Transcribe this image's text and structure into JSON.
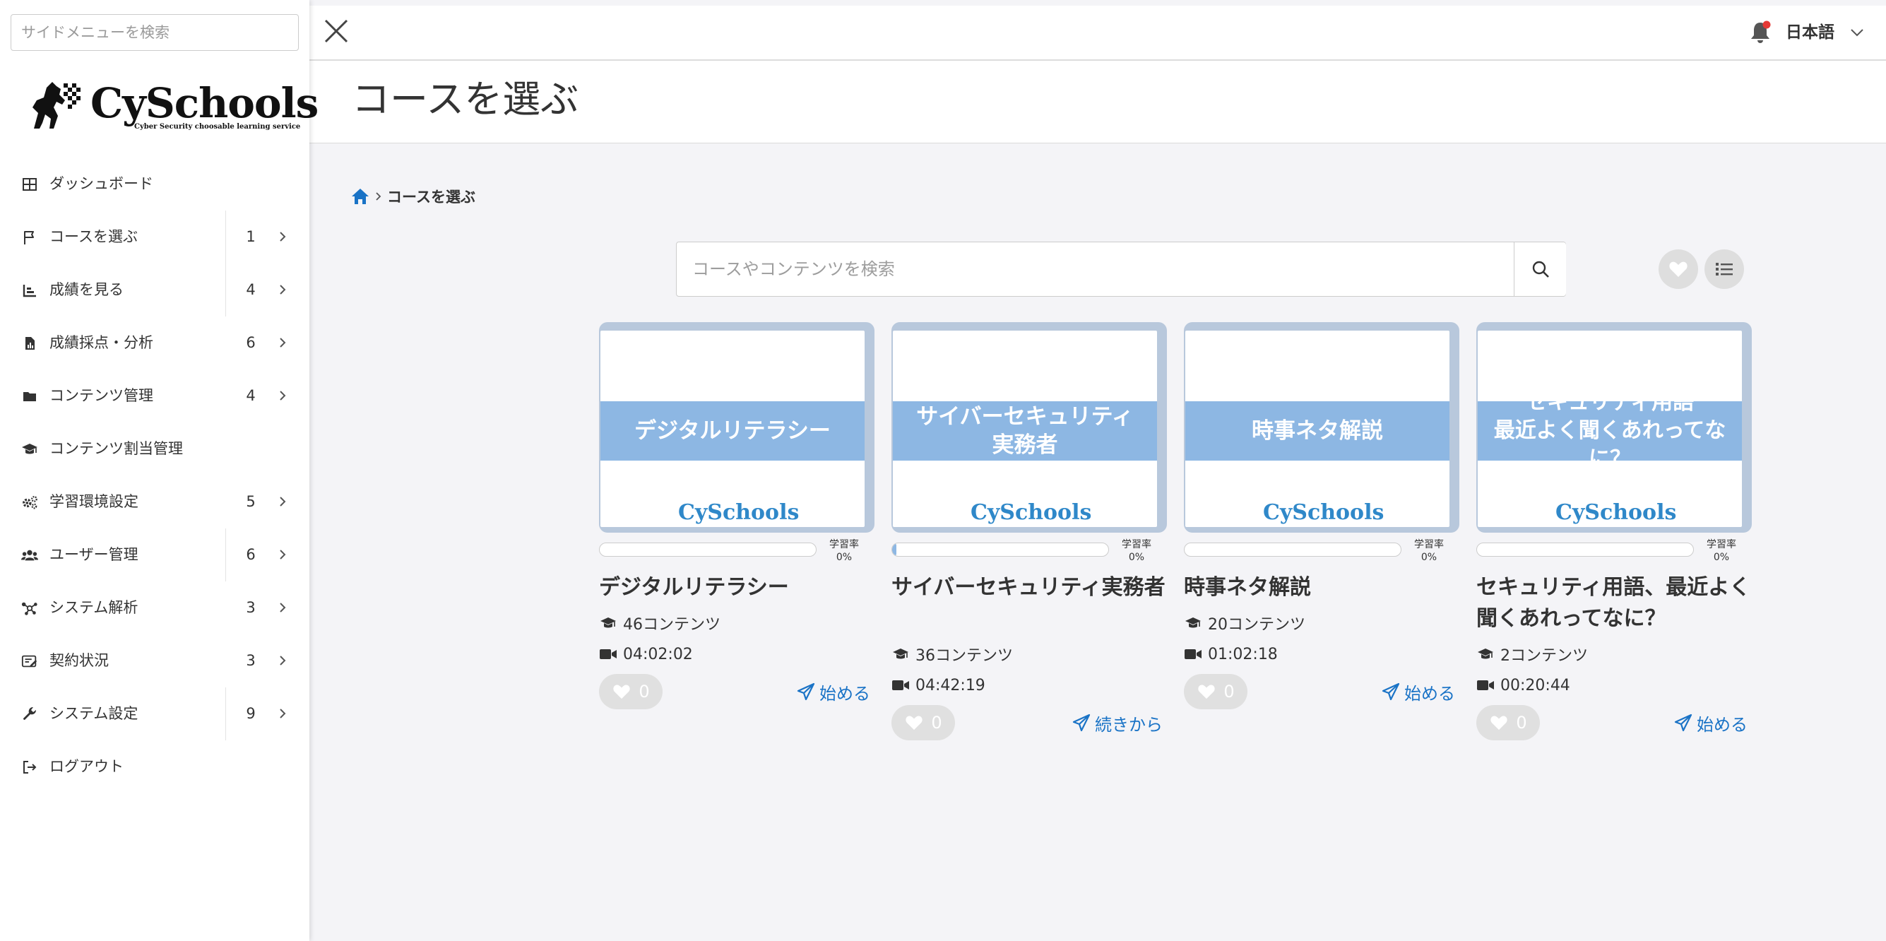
{
  "sidebar": {
    "search_placeholder": "サイドメニューを検索",
    "logo": {
      "name": "CySchools",
      "tagline": "Cyber Security choosable learning service"
    },
    "items": [
      {
        "icon": "grid-icon",
        "label": "ダッシュボード",
        "count": ""
      },
      {
        "icon": "flag-icon",
        "label": "コースを選ぶ",
        "count": "1"
      },
      {
        "icon": "chart-icon",
        "label": "成績を見る",
        "count": "4"
      },
      {
        "icon": "file-chart-icon",
        "label": "成績採点・分析",
        "count": "6"
      },
      {
        "icon": "folder-icon",
        "label": "コンテンツ管理",
        "count": "4"
      },
      {
        "icon": "graduation-cap-icon",
        "label": "コンテンツ割当管理",
        "count": ""
      },
      {
        "icon": "gears-icon",
        "label": "学習環境設定",
        "count": "5"
      },
      {
        "icon": "users-icon",
        "label": "ユーザー管理",
        "count": "6"
      },
      {
        "icon": "network-icon",
        "label": "システム解析",
        "count": "3"
      },
      {
        "icon": "contract-icon",
        "label": "契約状況",
        "count": "3"
      },
      {
        "icon": "wrench-icon",
        "label": "システム設定",
        "count": "9"
      },
      {
        "icon": "logout-icon",
        "label": "ログアウト",
        "count": ""
      }
    ]
  },
  "topbar": {
    "language": "日本語",
    "notification_dot_color": "#e53935"
  },
  "page": {
    "title": "コースを選ぶ"
  },
  "breadcrumb": {
    "current": "コースを選ぶ"
  },
  "search": {
    "placeholder": "コースやコンテンツを検索"
  },
  "colors": {
    "accent": "#1a73c6",
    "banner": "#8db7e3",
    "thumb_frame": "#b8c8dc"
  },
  "courses": [
    {
      "banner": "デジタルリテラシー",
      "thumb_logo": "CySchools",
      "title": "デジタルリテラシー",
      "rate_label": "学習率",
      "rate_value": "0%",
      "progress": 0,
      "contents": "46コンテンツ",
      "duration": "04:02:02",
      "likes": "0",
      "action": "始める"
    },
    {
      "banner": "サイバーセキュリティ\n実務者",
      "thumb_logo": "CySchools",
      "title": "サイバーセキュリティ実務者",
      "rate_label": "学習率",
      "rate_value": "0%",
      "progress": 0.02,
      "contents": "36コンテンツ",
      "duration": "04:42:19",
      "likes": "0",
      "action": "続きから"
    },
    {
      "banner": "時事ネタ解説",
      "thumb_logo": "CySchools",
      "title": "時事ネタ解説",
      "rate_label": "学習率",
      "rate_value": "0%",
      "progress": 0,
      "contents": "20コンテンツ",
      "duration": "01:02:18",
      "likes": "0",
      "action": "始める"
    },
    {
      "banner": "セキュリティ用語\n最近よく聞くあれってなに？",
      "thumb_logo": "CySchools",
      "title": "セキュリティ用語、最近よく聞くあれってなに？",
      "rate_label": "学習率",
      "rate_value": "0%",
      "progress": 0,
      "contents": "2コンテンツ",
      "duration": "00:20:44",
      "likes": "0",
      "action": "始める"
    }
  ]
}
